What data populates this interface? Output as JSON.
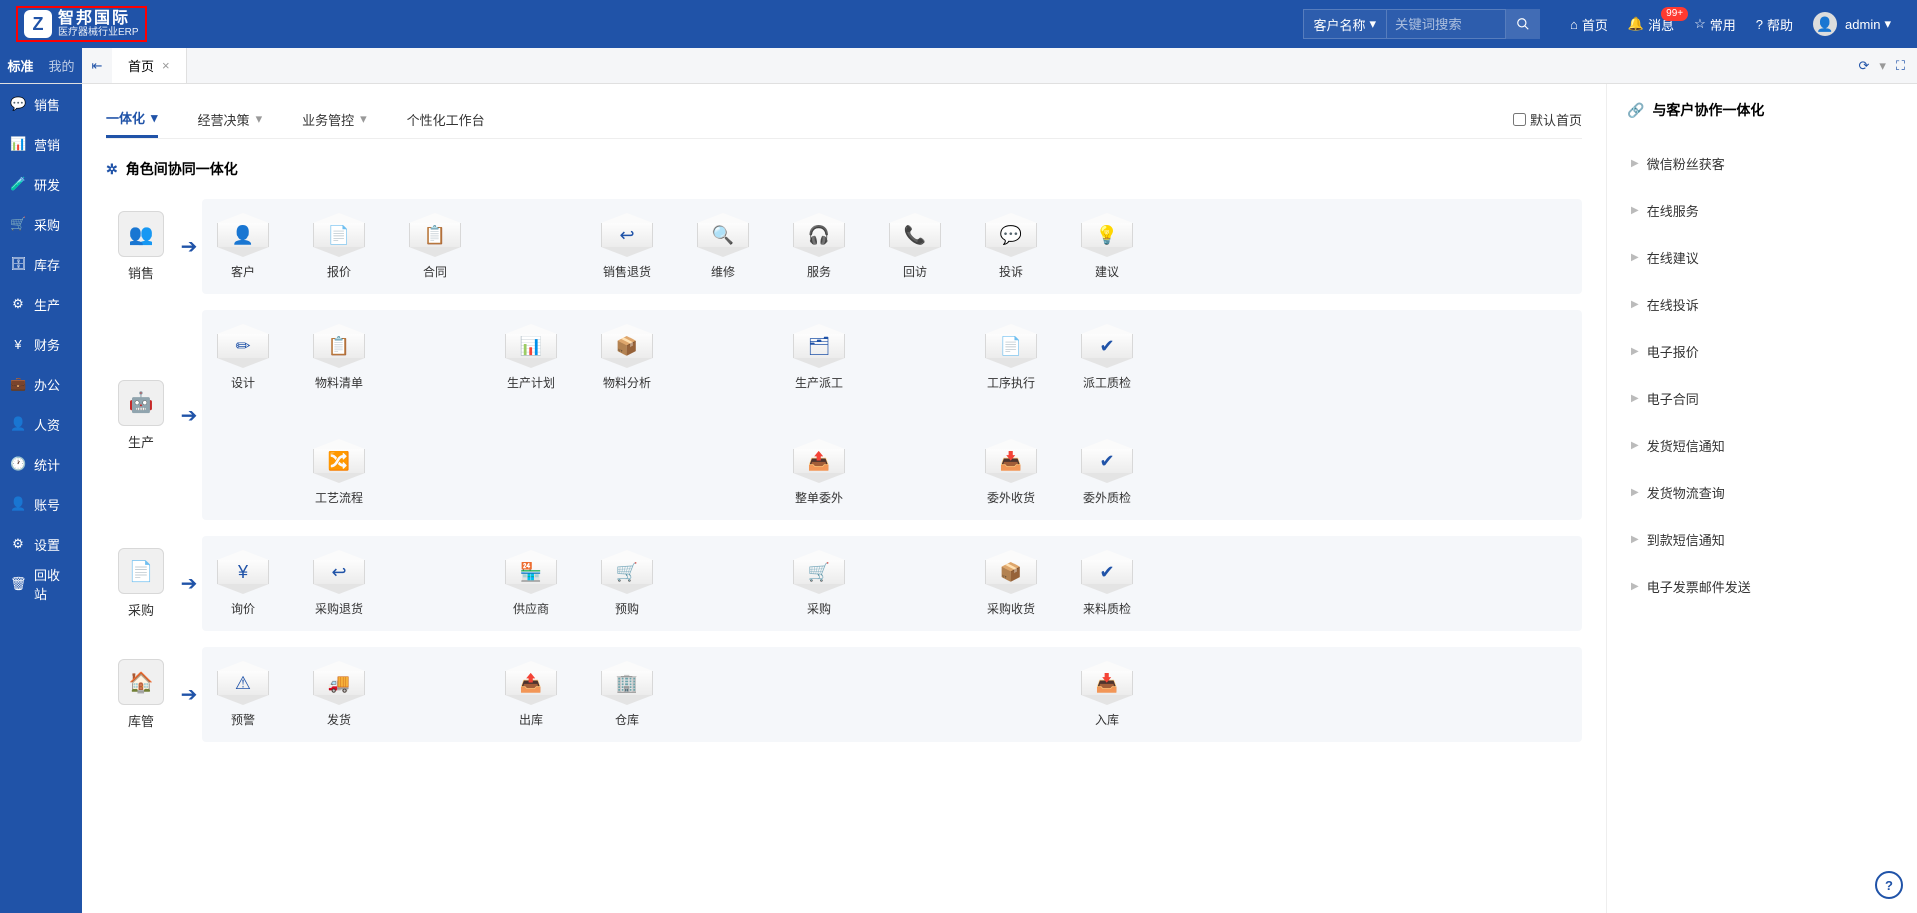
{
  "logo": {
    "main": "智邦国际",
    "sub": "医疗器械行业ERP"
  },
  "header": {
    "search_filter": "客户名称",
    "search_placeholder": "关键词搜索",
    "home": "首页",
    "messages": "消息",
    "messages_badge": "99+",
    "common": "常用",
    "help": "帮助",
    "user": "admin"
  },
  "mode_tabs": {
    "standard": "标准",
    "mine": "我的"
  },
  "page_tab": "首页",
  "sidebar": [
    {
      "icon": "💬",
      "label": "销售"
    },
    {
      "icon": "📊",
      "label": "营销"
    },
    {
      "icon": "🧪",
      "label": "研发"
    },
    {
      "icon": "🛒",
      "label": "采购"
    },
    {
      "icon": "🗄",
      "label": "库存"
    },
    {
      "icon": "⚙",
      "label": "生产"
    },
    {
      "icon": "¥",
      "label": "财务"
    },
    {
      "icon": "💼",
      "label": "办公"
    },
    {
      "icon": "👤",
      "label": "人资"
    },
    {
      "icon": "🕐",
      "label": "统计"
    },
    {
      "icon": "👤",
      "label": "账号"
    },
    {
      "icon": "⚙",
      "label": "设置"
    },
    {
      "icon": "🗑",
      "label": "回收站"
    }
  ],
  "content_tabs": {
    "integrated": "一体化",
    "decision": "经营决策",
    "control": "业务管控",
    "workspace": "个性化工作台",
    "default_home": "默认首页"
  },
  "section1_title": "角色间协同一体化",
  "section2_title": "与客户协作一体化",
  "rows": [
    {
      "head": {
        "icon": "👥",
        "label": "销售"
      },
      "nodes": [
        {
          "icon": "👤",
          "label": "客户"
        },
        {
          "icon": "📄",
          "label": "报价"
        },
        {
          "icon": "📋",
          "label": "合同"
        },
        null,
        {
          "icon": "↩",
          "label": "销售退货"
        },
        {
          "icon": "🔍",
          "label": "维修"
        },
        {
          "icon": "🎧",
          "label": "服务"
        },
        {
          "icon": "📞",
          "label": "回访"
        },
        {
          "icon": "💬",
          "label": "投诉"
        },
        {
          "icon": "💡",
          "label": "建议"
        }
      ]
    },
    {
      "head": {
        "icon": "🤖",
        "label": "生产"
      },
      "nodes": [
        {
          "icon": "✏",
          "label": "设计"
        },
        {
          "icon": "📋",
          "label": "物料清单"
        },
        null,
        {
          "icon": "📊",
          "label": "生产计划"
        },
        {
          "icon": "📦",
          "label": "物料分析"
        },
        null,
        {
          "icon": "🗂",
          "label": "生产派工"
        },
        null,
        {
          "icon": "📄",
          "label": "工序执行"
        },
        {
          "icon": "✔",
          "label": "派工质检"
        }
      ],
      "nodes2": [
        null,
        {
          "icon": "🔀",
          "label": "工艺流程"
        },
        null,
        null,
        null,
        null,
        {
          "icon": "📤",
          "label": "整单委外"
        },
        null,
        {
          "icon": "📥",
          "label": "委外收货"
        },
        {
          "icon": "✔",
          "label": "委外质检"
        }
      ]
    },
    {
      "head": {
        "icon": "📄",
        "label": "采购"
      },
      "nodes": [
        {
          "icon": "¥",
          "label": "询价"
        },
        {
          "icon": "↩",
          "label": "采购退货"
        },
        null,
        {
          "icon": "🏪",
          "label": "供应商"
        },
        {
          "icon": "🛒",
          "label": "预购"
        },
        null,
        {
          "icon": "🛒",
          "label": "采购"
        },
        null,
        {
          "icon": "📦",
          "label": "采购收货"
        },
        {
          "icon": "✔",
          "label": "来料质检"
        }
      ]
    },
    {
      "head": {
        "icon": "🏠",
        "label": "库管"
      },
      "nodes": [
        {
          "icon": "⚠",
          "label": "预警"
        },
        {
          "icon": "🚚",
          "label": "发货"
        },
        null,
        {
          "icon": "📤",
          "label": "出库"
        },
        {
          "icon": "🏢",
          "label": "仓库"
        },
        null,
        null,
        null,
        null,
        {
          "icon": "📥",
          "label": "入库"
        }
      ]
    }
  ],
  "right_items": [
    "微信粉丝获客",
    "在线服务",
    "在线建议",
    "在线投诉",
    "电子报价",
    "电子合同",
    "发货短信通知",
    "发货物流查询",
    "到款短信通知",
    "电子发票邮件发送"
  ]
}
